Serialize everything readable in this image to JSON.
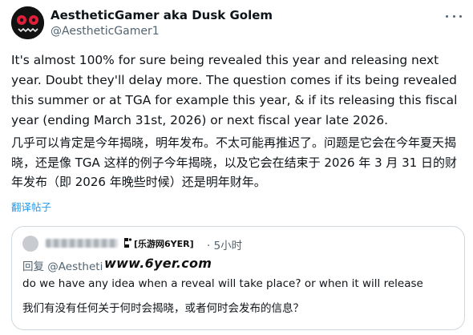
{
  "author": {
    "display_name": "AestheticGamer aka Dusk Golem",
    "handle": "@AestheticGamer1"
  },
  "tweet": {
    "text": "It's almost 100% for sure being revealed this year and releasing next year. Doubt they'll delay more. The question comes if its being revealed this summer or at TGA for example this year, & if its releasing this fiscal year (ending March 31st, 2026) or next fiscal year late 2026.",
    "translation": "几乎可以肯定是今年揭晓，明年发布。不太可能再推迟了。问题是它会在今年夏天揭晓，还是像 TGA 这样的例子今年揭晓，以及它会在结束于 2026 年 3 月 31 日的财年发布（即 2026 年晚些时候）还是明年财年。",
    "translate_label": "翻译帖子"
  },
  "quote": {
    "time": "· 5小时",
    "reply_to": "回复 @Aestheti",
    "text": "do we have any idea when a reveal will take place? or when it will release",
    "translation": "我们有没有任何关于何时会揭晓，或者何时会发布的信息？"
  },
  "watermark": {
    "label": "[乐游网6YER]",
    "url": "www.6yer.com"
  },
  "colors": {
    "text": "#0f1419",
    "secondary": "#536471",
    "link": "#1d9bf0",
    "border": "#cfd9de",
    "avatar_bg": "#121212",
    "avatar_eyes": "#e0203a"
  },
  "icons": {
    "more": "more-dots-icon",
    "watermark": "watermark-logo-icon"
  }
}
